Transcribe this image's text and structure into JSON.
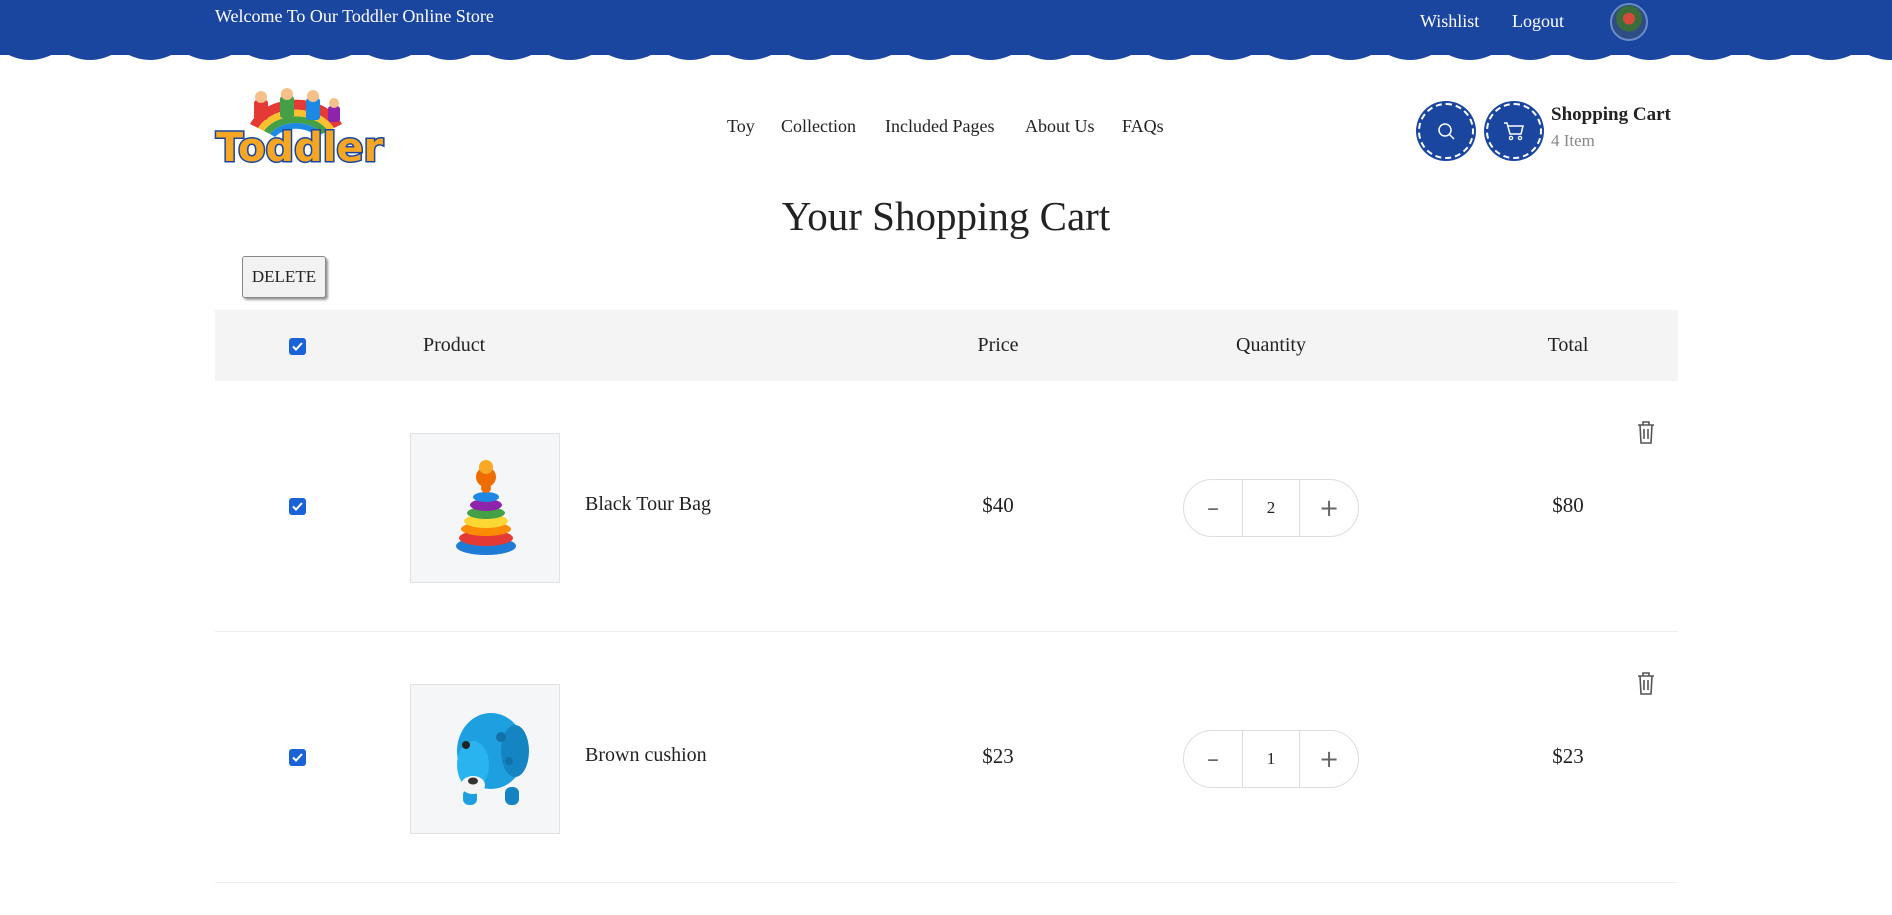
{
  "topbar": {
    "welcome": "Welcome To Our Toddler Online Store",
    "wishlist": "Wishlist",
    "logout": "Logout",
    "bg_color": "#1a46a0"
  },
  "header": {
    "logo_text": "Toddler",
    "nav": [
      "Toy",
      "Collection",
      "Included Pages",
      "About Us",
      "FAQs"
    ],
    "cart_title": "Shopping Cart",
    "cart_count": "4 Item"
  },
  "page": {
    "title": "Your Shopping Cart",
    "delete_label": "DELETE"
  },
  "table": {
    "headers": {
      "product": "Product",
      "price": "Price",
      "quantity": "Quantity",
      "total": "Total"
    },
    "rows": [
      {
        "name": "Black Tour Bag",
        "price": "$40",
        "qty": "2",
        "total": "$80",
        "image": "stacking-rings-toy"
      },
      {
        "name": "Brown cushion",
        "price": "$23",
        "qty": "1",
        "total": "$23",
        "image": "blue-elephant-toy"
      }
    ],
    "qty_minus": "–",
    "qty_plus": "+"
  },
  "colors": {
    "accent": "#1a46a0",
    "checkbox": "#1a63d6"
  }
}
